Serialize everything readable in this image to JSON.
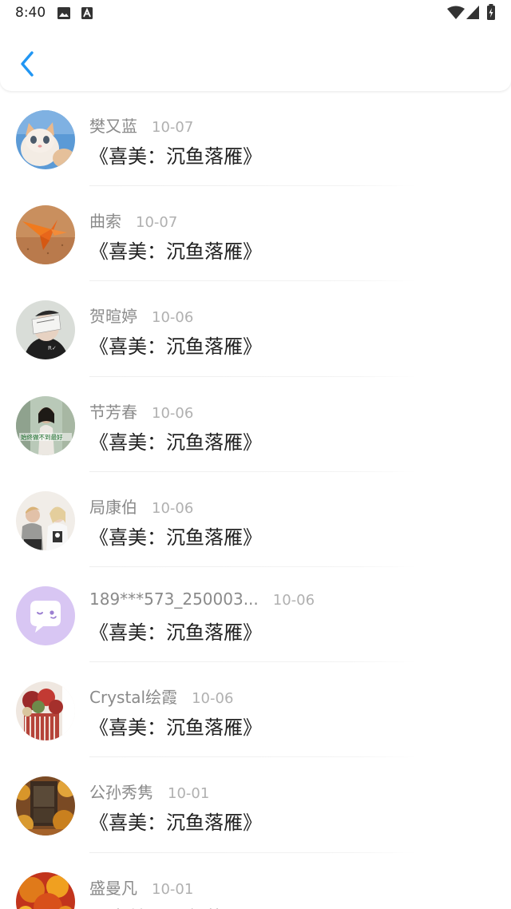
{
  "status_bar": {
    "time": "8:40",
    "icons": [
      "image-icon",
      "a-icon",
      "wifi-icon",
      "signal-icon",
      "battery-charging-icon"
    ]
  },
  "header": {
    "back_icon": "chevron-left-icon",
    "accent": "#2196F3"
  },
  "items": [
    {
      "name": "樊又蓝",
      "date": "10-07",
      "message": "《喜美：沉鱼落雁》",
      "avatar": "kitten"
    },
    {
      "name": "曲索",
      "date": "10-07",
      "message": "《喜美：沉鱼落雁》",
      "avatar": "paper-crane"
    },
    {
      "name": "贺暄婷",
      "date": "10-06",
      "message": "《喜美：沉鱼落雁》",
      "avatar": "person-mask"
    },
    {
      "name": "节芳春",
      "date": "10-06",
      "message": "《喜美：沉鱼落雁》",
      "avatar": "girl-street"
    },
    {
      "name": "局康伯",
      "date": "10-06",
      "message": "《喜美：沉鱼落雁》",
      "avatar": "couple"
    },
    {
      "name": "189***573_250003...",
      "date": "10-06",
      "message": "《喜美：沉鱼落雁》",
      "avatar": "chat-bubble"
    },
    {
      "name": "Crystal绘霞",
      "date": "10-06",
      "message": "《喜美：沉鱼落雁》",
      "avatar": "flowers"
    },
    {
      "name": "公孙秀隽",
      "date": "10-01",
      "message": "《喜美：沉鱼落雁》",
      "avatar": "autumn-door"
    },
    {
      "name": "盛曼凡",
      "date": "10-01",
      "message": "《喜美：沉鱼落雁》",
      "avatar": "autumn-tree"
    }
  ]
}
